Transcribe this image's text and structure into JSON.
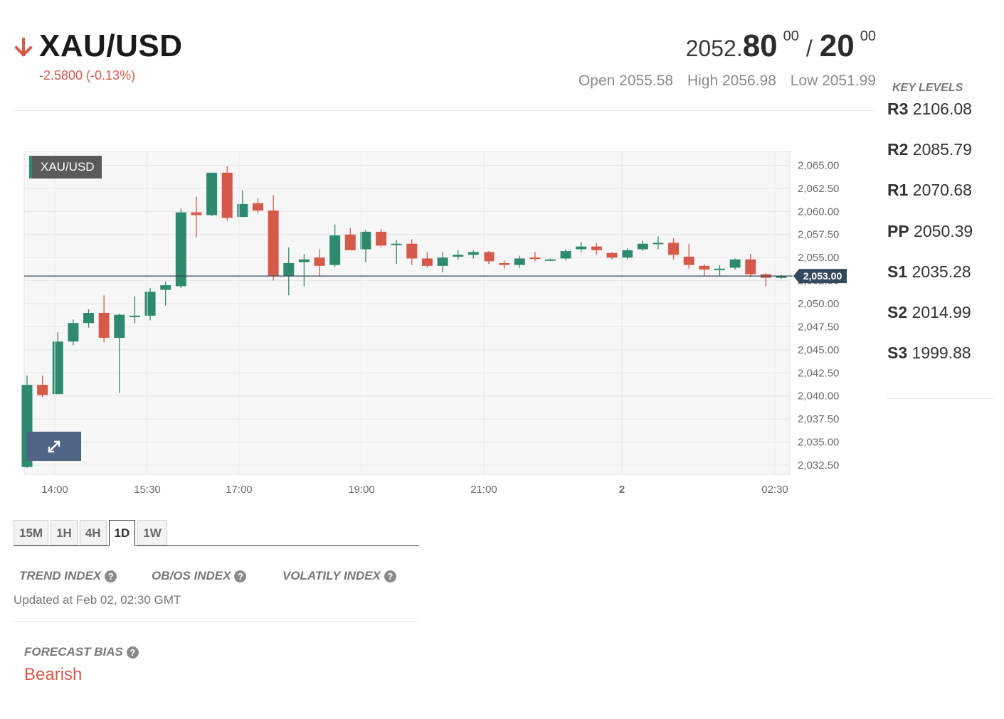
{
  "header": {
    "symbol": "XAU/USD",
    "change": "-2.5800 (-0.13%)",
    "direction_icon": "arrow-down-icon",
    "bid_prefix": "2052.",
    "bid_main": "80",
    "bid_sup": "00",
    "separator": "/",
    "ask_main": "20",
    "ask_sup": "00",
    "open": "Open 2055.58",
    "high": "High 2056.98",
    "low": "Low 2051.99"
  },
  "colors": {
    "bearish": "#d65a4a",
    "bullish": "#2e8a6e",
    "price_line": "#34495e",
    "expand_button": "#4e6585"
  },
  "key_levels": {
    "title": "KEY LEVELS",
    "items": [
      {
        "name": "R3",
        "value": "2106.08"
      },
      {
        "name": "R2",
        "value": "2085.79"
      },
      {
        "name": "R1",
        "value": "2070.68"
      },
      {
        "name": "PP",
        "value": "2050.39"
      },
      {
        "name": "S1",
        "value": "2035.28"
      },
      {
        "name": "S2",
        "value": "2014.99"
      },
      {
        "name": "S3",
        "value": "1999.88"
      }
    ]
  },
  "chart": {
    "label": "XAU/USD",
    "current_price_label": "2,053.00",
    "expand_icon": "expand-icon"
  },
  "chart_data": {
    "type": "candlestick",
    "title": "XAU/USD",
    "ylim": [
      2031.5,
      2066.5
    ],
    "y_ticks": [
      "2,065.00",
      "2,062.50",
      "2,060.00",
      "2,057.50",
      "2,055.00",
      "2,052.50",
      "2,050.00",
      "2,047.50",
      "2,045.00",
      "2,042.50",
      "2,040.00",
      "2,037.50",
      "2,035.00",
      "2,032.50"
    ],
    "x_ticks": [
      "14:00",
      "15:30",
      "17:00",
      "19:00",
      "21:00",
      "2",
      "02:30"
    ],
    "current_price": 2053.0,
    "candles": [
      {
        "o": 2032.3,
        "h": 2042.2,
        "l": 2032.2,
        "c": 2041.2
      },
      {
        "o": 2041.2,
        "h": 2042.2,
        "l": 2039.9,
        "c": 2040.1
      },
      {
        "o": 2040.2,
        "h": 2046.9,
        "l": 2040.2,
        "c": 2045.9
      },
      {
        "o": 2045.9,
        "h": 2048.3,
        "l": 2045.5,
        "c": 2047.9
      },
      {
        "o": 2047.9,
        "h": 2049.4,
        "l": 2047.4,
        "c": 2049.0
      },
      {
        "o": 2049.0,
        "h": 2050.9,
        "l": 2045.8,
        "c": 2046.3
      },
      {
        "o": 2046.3,
        "h": 2048.9,
        "l": 2040.3,
        "c": 2048.8
      },
      {
        "o": 2048.6,
        "h": 2050.8,
        "l": 2047.9,
        "c": 2048.7
      },
      {
        "o": 2048.7,
        "h": 2051.7,
        "l": 2048.2,
        "c": 2051.3
      },
      {
        "o": 2051.5,
        "h": 2052.4,
        "l": 2049.8,
        "c": 2052.0
      },
      {
        "o": 2051.9,
        "h": 2060.3,
        "l": 2051.7,
        "c": 2059.9
      },
      {
        "o": 2059.9,
        "h": 2061.6,
        "l": 2057.2,
        "c": 2059.6
      },
      {
        "o": 2059.6,
        "h": 2064.2,
        "l": 2059.5,
        "c": 2064.2
      },
      {
        "o": 2064.2,
        "h": 2064.9,
        "l": 2059.0,
        "c": 2059.3
      },
      {
        "o": 2059.4,
        "h": 2062.3,
        "l": 2059.4,
        "c": 2060.8
      },
      {
        "o": 2060.9,
        "h": 2061.4,
        "l": 2059.8,
        "c": 2060.1
      },
      {
        "o": 2060.1,
        "h": 2061.8,
        "l": 2052.5,
        "c": 2053.0
      },
      {
        "o": 2053.0,
        "h": 2056.1,
        "l": 2050.9,
        "c": 2054.4
      },
      {
        "o": 2054.5,
        "h": 2055.4,
        "l": 2051.9,
        "c": 2054.8
      },
      {
        "o": 2055.0,
        "h": 2055.9,
        "l": 2053.0,
        "c": 2054.1
      },
      {
        "o": 2054.2,
        "h": 2058.6,
        "l": 2054.0,
        "c": 2057.4
      },
      {
        "o": 2057.5,
        "h": 2058.2,
        "l": 2055.9,
        "c": 2055.8
      },
      {
        "o": 2055.9,
        "h": 2058.0,
        "l": 2054.5,
        "c": 2057.8
      },
      {
        "o": 2057.8,
        "h": 2058.1,
        "l": 2056.1,
        "c": 2056.3
      },
      {
        "o": 2056.4,
        "h": 2056.9,
        "l": 2054.3,
        "c": 2056.5
      },
      {
        "o": 2056.5,
        "h": 2057.0,
        "l": 2054.2,
        "c": 2054.9
      },
      {
        "o": 2054.9,
        "h": 2055.6,
        "l": 2053.9,
        "c": 2054.1
      },
      {
        "o": 2054.1,
        "h": 2055.6,
        "l": 2053.4,
        "c": 2055.0
      },
      {
        "o": 2055.1,
        "h": 2055.8,
        "l": 2054.8,
        "c": 2055.3
      },
      {
        "o": 2055.3,
        "h": 2055.8,
        "l": 2054.9,
        "c": 2055.6
      },
      {
        "o": 2055.6,
        "h": 2055.7,
        "l": 2054.3,
        "c": 2054.6
      },
      {
        "o": 2054.4,
        "h": 2054.7,
        "l": 2053.8,
        "c": 2054.2
      },
      {
        "o": 2054.2,
        "h": 2055.2,
        "l": 2053.9,
        "c": 2054.9
      },
      {
        "o": 2055.0,
        "h": 2055.6,
        "l": 2054.6,
        "c": 2054.9
      },
      {
        "o": 2054.8,
        "h": 2054.9,
        "l": 2054.7,
        "c": 2054.8
      },
      {
        "o": 2054.9,
        "h": 2055.9,
        "l": 2054.7,
        "c": 2055.7
      },
      {
        "o": 2055.9,
        "h": 2056.7,
        "l": 2055.6,
        "c": 2056.2
      },
      {
        "o": 2056.2,
        "h": 2056.6,
        "l": 2055.3,
        "c": 2055.8
      },
      {
        "o": 2055.5,
        "h": 2055.6,
        "l": 2054.8,
        "c": 2055.0
      },
      {
        "o": 2055.0,
        "h": 2056.0,
        "l": 2054.8,
        "c": 2055.8
      },
      {
        "o": 2055.9,
        "h": 2056.8,
        "l": 2055.7,
        "c": 2056.5
      },
      {
        "o": 2056.5,
        "h": 2057.3,
        "l": 2055.9,
        "c": 2056.6
      },
      {
        "o": 2056.6,
        "h": 2057.1,
        "l": 2054.8,
        "c": 2055.3
      },
      {
        "o": 2055.1,
        "h": 2056.5,
        "l": 2053.8,
        "c": 2054.2
      },
      {
        "o": 2054.1,
        "h": 2054.3,
        "l": 2053.0,
        "c": 2053.7
      },
      {
        "o": 2053.8,
        "h": 2054.2,
        "l": 2053.0,
        "c": 2053.8
      },
      {
        "o": 2053.9,
        "h": 2054.9,
        "l": 2053.7,
        "c": 2054.8
      },
      {
        "o": 2054.8,
        "h": 2055.4,
        "l": 2052.9,
        "c": 2053.2
      },
      {
        "o": 2053.2,
        "h": 2053.3,
        "l": 2051.9,
        "c": 2052.8
      },
      {
        "o": 2052.8,
        "h": 2053.1,
        "l": 2052.7,
        "c": 2053.0
      }
    ]
  },
  "timeframes": {
    "items": [
      "15M",
      "1H",
      "4H",
      "1D",
      "1W"
    ],
    "active": "1D"
  },
  "indices": {
    "trend": "TREND INDEX",
    "obos": "OB/OS INDEX",
    "volatility": "VOLATILY INDEX",
    "help_glyph": "?",
    "updated": "Updated at Feb 02, 02:30 GMT"
  },
  "forecast": {
    "title": "FORECAST BIAS",
    "value": "Bearish"
  }
}
